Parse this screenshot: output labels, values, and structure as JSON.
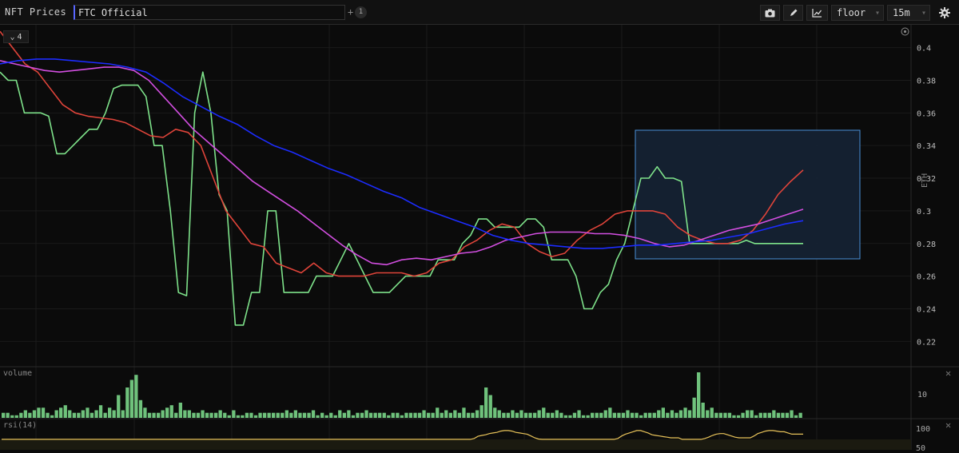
{
  "toolbar": {
    "app_title": "NFT Prices",
    "search_value": "FTC Official",
    "plus": "+",
    "count_badge": "1",
    "metric_select": "floor",
    "interval_select": "15m"
  },
  "price_pane": {
    "series_count": "4",
    "y_axis_label": "ETH",
    "y_ticks": [
      "0.4",
      "0.38",
      "0.36",
      "0.34",
      "0.32",
      "0.3",
      "0.28",
      "0.26",
      "0.24",
      "0.22"
    ],
    "ylim": [
      0.205,
      0.414
    ]
  },
  "volume_pane": {
    "label": "volume",
    "tick": "10"
  },
  "rsi_pane": {
    "label": "rsi(14)",
    "tick_top": "100",
    "tick_mid": "50"
  },
  "colors": {
    "floor": "#7ee28a",
    "ma_red": "#e0443a",
    "ma_magenta": "#d24ee0",
    "ma_blue": "#1c2cff",
    "volume": "#6fc27c",
    "rsi": "#e8c35a",
    "selection": "#4a90d9"
  },
  "chart_data": [
    {
      "type": "line",
      "title": "",
      "ylabel": "ETH",
      "ylim": [
        0.205,
        0.414
      ],
      "n_points": 100,
      "series": [
        {
          "name": "",
          "color": "#7ee28a",
          "values": [
            0.385,
            0.38,
            0.38,
            0.36,
            0.36,
            0.36,
            0.358,
            0.335,
            0.335,
            0.34,
            0.345,
            0.35,
            0.35,
            0.36,
            0.375,
            0.377,
            0.377,
            0.377,
            0.37,
            0.34,
            0.34,
            0.3,
            0.25,
            0.248,
            0.36,
            0.385,
            0.36,
            0.31,
            0.3,
            0.23,
            0.23,
            0.25,
            0.25,
            0.3,
            0.3,
            0.25,
            0.25,
            0.25,
            0.25,
            0.26,
            0.26,
            0.26,
            0.27,
            0.28,
            0.27,
            0.26,
            0.25,
            0.25,
            0.25,
            0.255,
            0.26,
            0.26,
            0.26,
            0.26,
            0.27,
            0.27,
            0.27,
            0.28,
            0.285,
            0.295,
            0.295,
            0.29,
            0.29,
            0.29,
            0.29,
            0.295,
            0.295,
            0.29,
            0.27,
            0.27,
            0.27,
            0.26,
            0.24,
            0.24,
            0.25,
            0.255,
            0.27,
            0.28,
            0.3,
            0.32,
            0.32,
            0.327,
            0.32,
            0.32,
            0.318,
            0.28,
            0.28,
            0.28,
            0.28,
            0.28,
            0.28,
            0.28,
            0.282,
            0.28,
            0.28,
            0.28,
            0.28,
            0.28,
            0.28,
            0.28
          ]
        },
        {
          "name": "",
          "color": "#e0443a",
          "values": [
            0.41,
            0.4,
            0.39,
            0.385,
            0.375,
            0.365,
            0.36,
            0.358,
            0.357,
            0.356,
            0.354,
            0.35,
            0.346,
            0.345,
            0.35,
            0.348,
            0.34,
            0.32,
            0.3,
            0.29,
            0.28,
            0.278,
            0.268,
            0.265,
            0.262,
            0.268,
            0.262,
            0.26,
            0.26,
            0.26,
            0.262,
            0.262,
            0.262,
            0.26,
            0.262,
            0.268,
            0.27,
            0.278,
            0.282,
            0.288,
            0.292,
            0.29,
            0.28,
            0.275,
            0.272,
            0.274,
            0.282,
            0.288,
            0.292,
            0.298,
            0.3,
            0.3,
            0.3,
            0.298,
            0.29,
            0.285,
            0.282,
            0.28,
            0.28,
            0.282,
            0.288,
            0.298,
            0.31,
            0.318,
            0.325
          ]
        },
        {
          "name": "",
          "color": "#d24ee0",
          "values": [
            0.392,
            0.39,
            0.388,
            0.386,
            0.385,
            0.386,
            0.387,
            0.388,
            0.388,
            0.386,
            0.38,
            0.37,
            0.36,
            0.35,
            0.342,
            0.334,
            0.326,
            0.318,
            0.312,
            0.306,
            0.3,
            0.293,
            0.286,
            0.279,
            0.273,
            0.268,
            0.267,
            0.27,
            0.271,
            0.27,
            0.272,
            0.274,
            0.275,
            0.278,
            0.282,
            0.284,
            0.286,
            0.287,
            0.287,
            0.287,
            0.286,
            0.286,
            0.285,
            0.283,
            0.28,
            0.278,
            0.279,
            0.282,
            0.285,
            0.288,
            0.29,
            0.292,
            0.295,
            0.298,
            0.301
          ]
        },
        {
          "name": "",
          "color": "#1c2cff",
          "values": [
            0.39,
            0.392,
            0.393,
            0.393,
            0.392,
            0.391,
            0.39,
            0.388,
            0.385,
            0.378,
            0.37,
            0.364,
            0.358,
            0.353,
            0.346,
            0.34,
            0.336,
            0.331,
            0.326,
            0.322,
            0.317,
            0.312,
            0.308,
            0.302,
            0.298,
            0.294,
            0.29,
            0.285,
            0.282,
            0.28,
            0.279,
            0.278,
            0.277,
            0.277,
            0.278,
            0.279,
            0.279,
            0.28,
            0.281,
            0.282,
            0.284,
            0.286,
            0.289,
            0.292,
            0.294
          ]
        }
      ]
    },
    {
      "type": "bar",
      "title": "",
      "ylabel": "",
      "series": [
        {
          "name": "",
          "values": [
            2,
            2,
            1,
            1,
            2,
            3,
            2,
            3,
            4,
            4,
            2,
            1,
            3,
            4,
            5,
            3,
            2,
            2,
            3,
            4,
            2,
            3,
            5,
            2,
            4,
            3,
            9,
            3,
            12,
            15,
            17,
            7,
            4,
            2,
            2,
            2,
            3,
            4,
            5,
            2,
            6,
            3,
            3,
            2,
            2,
            3,
            2,
            2,
            2,
            3,
            2,
            1,
            3,
            1,
            1,
            2,
            2,
            1,
            2,
            2,
            2,
            2,
            2,
            2,
            3,
            2,
            3,
            2,
            2,
            2,
            3,
            1,
            2,
            1,
            2,
            1,
            3,
            2,
            3,
            1,
            2,
            2,
            3,
            2,
            2,
            2,
            2,
            1,
            2,
            2,
            1,
            2,
            2,
            2,
            2,
            3,
            2,
            2,
            4,
            2,
            3,
            2,
            3,
            2,
            4,
            2,
            2,
            3,
            5,
            12,
            9,
            4,
            3,
            2,
            2,
            3,
            2,
            3,
            2,
            2,
            2,
            3,
            4,
            2,
            2,
            3,
            2,
            1,
            1,
            2,
            3,
            1,
            1,
            2,
            2,
            2,
            3,
            4,
            2,
            2,
            2,
            3,
            2,
            2,
            1,
            2,
            2,
            2,
            3,
            4,
            2,
            3,
            2,
            3,
            4,
            3,
            8,
            18,
            6,
            3,
            4,
            2,
            2,
            2,
            2,
            1,
            1,
            2,
            3,
            3,
            1,
            2,
            2,
            2,
            3,
            2,
            2,
            2,
            3,
            1,
            2
          ]
        }
      ]
    },
    {
      "type": "line",
      "title": "",
      "ylim": [
        0,
        100
      ],
      "series": [
        {
          "name": "",
          "values": [
            45,
            45,
            45,
            45,
            45,
            45,
            45,
            45,
            45,
            45,
            45,
            45,
            45,
            45,
            45,
            45,
            45,
            45,
            45,
            45,
            45,
            45,
            45,
            45,
            45,
            45,
            45,
            45,
            45,
            45,
            45,
            45,
            45,
            45,
            45,
            45,
            45,
            45,
            45,
            45,
            45,
            45,
            45,
            45,
            45,
            45,
            45,
            45,
            45,
            45,
            45,
            45,
            45,
            45,
            45,
            45,
            45,
            45,
            45,
            45,
            45,
            45,
            45,
            45,
            45,
            45,
            45,
            45,
            45,
            45,
            45,
            45,
            45,
            45,
            45,
            45,
            45,
            45,
            45,
            45,
            45,
            45,
            45,
            45,
            45,
            45,
            45,
            45,
            45,
            45,
            45,
            45,
            45,
            45,
            45,
            45,
            45,
            45,
            45,
            45,
            45,
            45,
            45,
            45,
            45,
            45,
            45,
            45,
            45,
            45,
            45,
            45,
            45,
            45,
            45,
            45,
            45,
            45,
            45,
            45,
            45,
            45,
            45,
            45,
            45,
            48,
            55,
            58,
            60,
            64,
            66,
            68,
            72,
            74,
            74,
            72,
            68,
            66,
            64,
            62,
            56,
            50,
            46,
            45,
            45,
            45,
            45,
            45,
            45,
            45,
            45,
            45,
            45,
            45,
            45,
            45,
            45,
            45,
            45,
            45,
            45,
            45,
            45,
            48,
            56,
            62,
            66,
            70,
            74,
            74,
            70,
            66,
            60,
            58,
            56,
            54,
            52,
            50,
            50,
            50,
            45,
            45,
            45,
            45,
            45,
            45,
            48,
            52,
            58,
            62,
            64,
            64,
            60,
            56,
            52,
            50,
            50,
            50,
            50,
            56,
            64,
            68,
            72,
            74,
            74,
            72,
            70,
            70,
            66,
            62,
            62,
            62,
            62
          ]
        }
      ]
    }
  ]
}
